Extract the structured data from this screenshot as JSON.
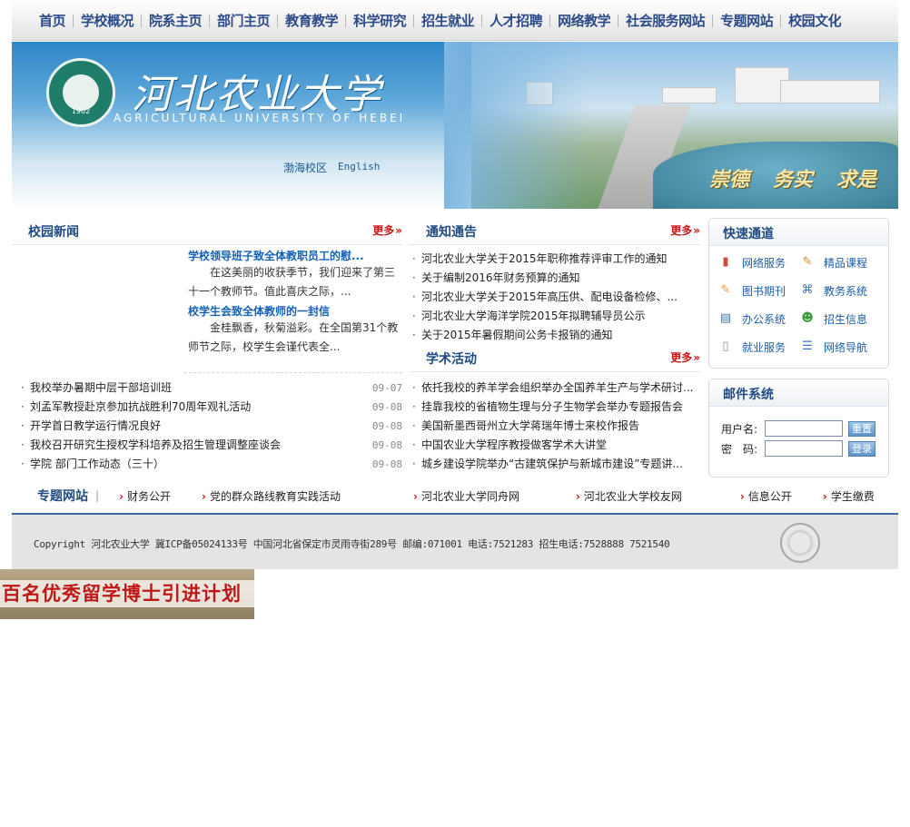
{
  "topnav": [
    "首页",
    "学校概况",
    "院系主页",
    "部门主页",
    "教育教学",
    "科学研究",
    "招生就业",
    "人才招聘",
    "网络教学",
    "社会服务网站",
    "专题网站",
    "校园文化"
  ],
  "banner": {
    "univ_cn": "河北农业大学",
    "univ_en": "AGRICULTURAL UNIVERSITY OF HEBEI",
    "emblem_year": "1902",
    "campus_link": "渤海校区",
    "english_link": "English",
    "motto": [
      "崇德",
      "务实",
      "求是"
    ]
  },
  "news": {
    "title": "校园新闻",
    "more": "更多",
    "features": [
      {
        "title": "学校领导班子致全体教职员工的慰...",
        "summary": "在这美丽的收获季节，我们迎来了第三十一个教师节。值此喜庆之际，..."
      },
      {
        "title": "校学生会致全体教师的一封信",
        "summary": "金桂飘香，秋菊溢彩。在全国第31个教师节之际，校学生会谨代表全..."
      }
    ],
    "items": [
      {
        "text": "我校举办暑期中层干部培训班",
        "date": "09-07"
      },
      {
        "text": "刘孟军教授赴京参加抗战胜利70周年观礼活动",
        "date": "09-08"
      },
      {
        "text": "开学首日教学运行情况良好",
        "date": "09-08"
      },
      {
        "text": "我校召开研究生授权学科培养及招生管理调整座谈会",
        "date": "09-08"
      },
      {
        "text": "学院 部门工作动态（三十）",
        "date": "09-08"
      }
    ]
  },
  "notices": {
    "title": "通知通告",
    "more": "更多",
    "items": [
      "河北农业大学关于2015年职称推荐评审工作的通知",
      "关于编制2016年财务预算的通知",
      "河北农业大学关于2015年高压供、配电设备检修、...",
      "河北农业大学海洋学院2015年拟聘辅导员公示",
      "关于2015年暑假期间公务卡报销的通知"
    ]
  },
  "academic": {
    "title": "学术活动",
    "more": "更多",
    "items": [
      "依托我校的养羊学会组织举办全国养羊生产与学术研讨...",
      "挂靠我校的省植物生理与分子生物学会举办专题报告会",
      "美国新墨西哥州立大学蒋瑞年博士来校作报告",
      "中国农业大学程序教授做客学术大讲堂",
      "城乡建设学院举办“古建筑保护与新城市建设”专题讲..."
    ]
  },
  "quick": {
    "title": "快速通道",
    "items": [
      {
        "label": "网络服务",
        "icon": "chart-icon",
        "glyph": "▮"
      },
      {
        "label": "精品课程",
        "icon": "edit-icon",
        "glyph": "✎"
      },
      {
        "label": "图书期刊",
        "icon": "notebook-icon",
        "glyph": "✎"
      },
      {
        "label": "教务系统",
        "icon": "tag-icon",
        "glyph": "⌘"
      },
      {
        "label": "办公系统",
        "icon": "window-icon",
        "glyph": "▤"
      },
      {
        "label": "招生信息",
        "icon": "users-icon",
        "glyph": "☻"
      },
      {
        "label": "就业服务",
        "icon": "document-icon",
        "glyph": "▯"
      },
      {
        "label": "网络导航",
        "icon": "list-icon",
        "glyph": "☰"
      }
    ]
  },
  "mail": {
    "title": "邮件系统",
    "username_label": "用户名:",
    "password_label": "密　码:",
    "username_value": "",
    "password_value": "",
    "reset_label": "重置",
    "login_label": "登录"
  },
  "special": {
    "title": "专题网站",
    "links": [
      "财务公开",
      "党的群众路线教育实践活动",
      "河北农业大学同舟网",
      "河北农业大学校友网",
      "信息公开",
      "学生缴费"
    ]
  },
  "footer": {
    "copyright": "Copyright 河北农业大学 冀ICP备05024133号 中国河北省保定市灵雨寺街289号  邮编:071001  电话:7521283  招生电话:7528888 7521540"
  },
  "ad": {
    "text": "百名优秀留学博士引进计划"
  },
  "colors": {
    "nav_text": "#2c4a8a",
    "section_title": "#1f4b82",
    "more_link": "#c81818",
    "feature_title": "#1561b4",
    "footer_border": "#3c6aa0"
  }
}
